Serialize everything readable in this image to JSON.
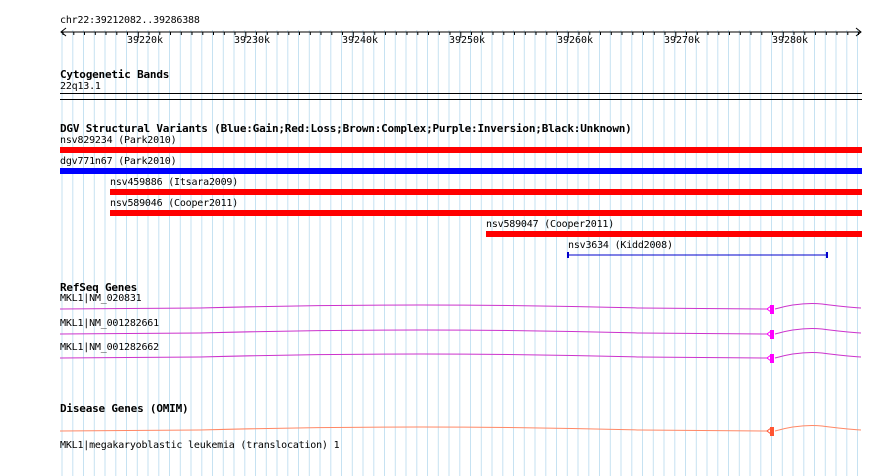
{
  "region": "chr22:39212082..39286388",
  "ruler": {
    "ticks": [
      "39220k",
      "39230k",
      "39240k",
      "39250k",
      "39260k",
      "39270k",
      "39280k"
    ]
  },
  "cytobands": {
    "title": "Cytogenetic Bands",
    "band": "22q13.1"
  },
  "dgv": {
    "title": "DGV Structural Variants (Blue:Gain;Red:Loss;Brown:Complex;Purple:Inversion;Black:Unknown)",
    "variants": [
      {
        "label": "nsv829234 (Park2010)",
        "color": "#ff0000"
      },
      {
        "label": "dgv771n67 (Park2010)",
        "color": "#0000ff"
      },
      {
        "label": "nsv459886 (Itsara2009)",
        "color": "#ff0000"
      },
      {
        "label": "nsv589046 (Cooper2011)",
        "color": "#ff0000"
      },
      {
        "label": "nsv589047 (Cooper2011)",
        "color": "#ff0000"
      },
      {
        "label": "nsv3634 (Kidd2008)",
        "color": "#0000cc"
      }
    ]
  },
  "refseq": {
    "title": "RefSeq Genes",
    "color": "#cc33cc",
    "exon_color": "#ff00ff",
    "genes": [
      {
        "label": "MKL1|NM_020831"
      },
      {
        "label": "MKL1|NM_001282661"
      },
      {
        "label": "MKL1|NM_001282662"
      }
    ]
  },
  "omim": {
    "title": "Disease Genes (OMIM)",
    "color": "#ff8866",
    "exon_color": "#ff5533",
    "genes": [
      {
        "label": "MKL1|megakaryoblastic leukemia (translocation) 1"
      }
    ]
  }
}
